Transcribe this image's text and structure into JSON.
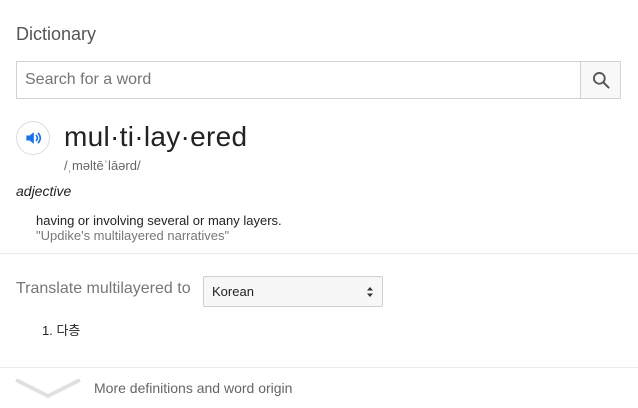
{
  "header": {
    "title": "Dictionary"
  },
  "search": {
    "placeholder": "Search for a word",
    "value": "",
    "button_icon": "search-icon"
  },
  "entry": {
    "audio_icon": "speaker-icon",
    "word": "mul·ti·lay·ered",
    "phonetic": "/ˌməltēˈlāərd/",
    "part_of_speech": "adjective",
    "definitions": [
      {
        "text": "having or involving several or many layers.",
        "example": "\"Updike's multilayered narratives\""
      }
    ]
  },
  "translate": {
    "label": "Translate multilayered to",
    "selected_language": "Korean",
    "results": [
      {
        "number": "1.",
        "text": "다층"
      }
    ]
  },
  "footer": {
    "more_label": "More definitions and word origin",
    "chevron_icon": "chevron-down-icon"
  },
  "colors": {
    "accent_blue": "#1a73e8",
    "border": "#d2d2d2",
    "muted_text": "#777777"
  }
}
